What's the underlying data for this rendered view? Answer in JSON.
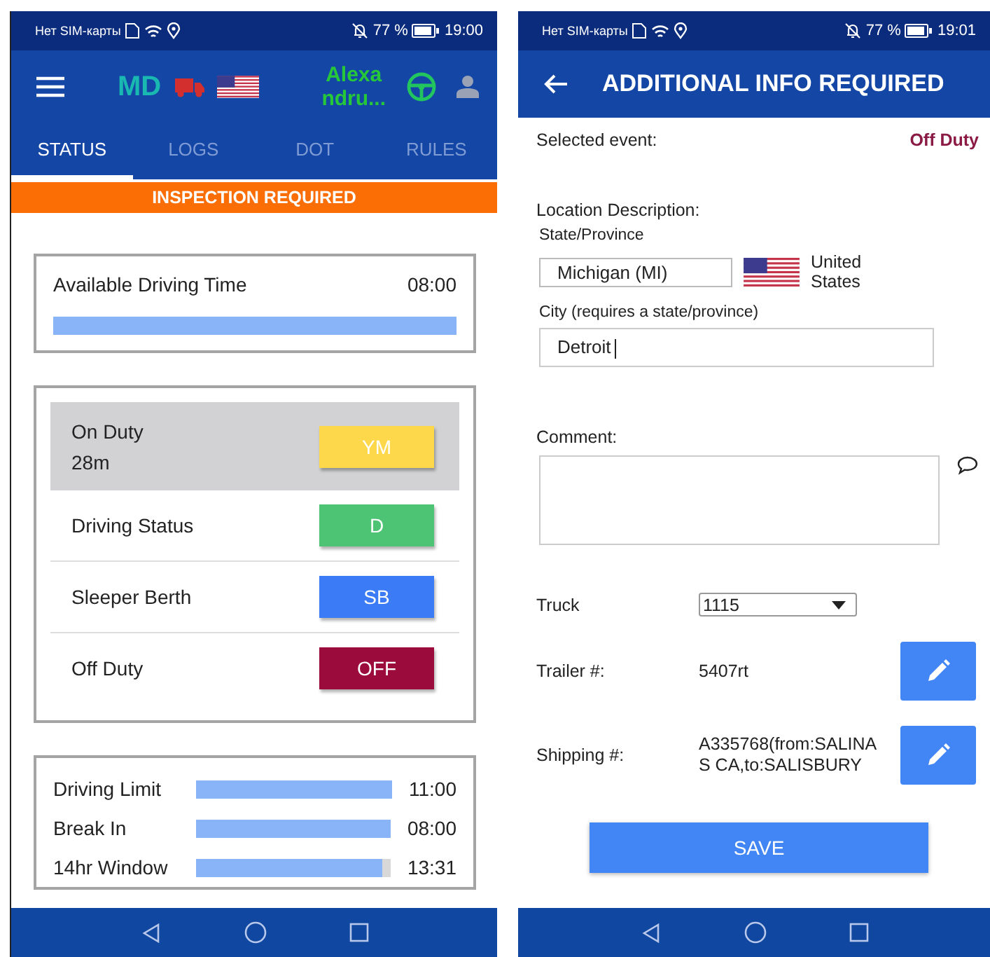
{
  "status_screen": {
    "status_bar": {
      "carrier": "Нет SIM-карты",
      "battery": "77 %",
      "time": "19:00"
    },
    "header": {
      "initials": "MD",
      "driver": "Alexandru..."
    },
    "tabs": [
      {
        "label": "STATUS",
        "selected": true
      },
      {
        "label": "LOGS",
        "selected": false
      },
      {
        "label": "DOT",
        "selected": false
      },
      {
        "label": "RULES",
        "selected": false
      }
    ],
    "banner": "INSPECTION REQUIRED",
    "available": {
      "label": "Available Driving Time",
      "value": "08:00",
      "level": 1
    },
    "statuses": [
      {
        "label": "On Duty",
        "sub": "28m",
        "code": "YM",
        "color": "#fdd84a",
        "selected": true
      },
      {
        "label": "Driving Status",
        "code": "D",
        "color": "#4cc474",
        "selected": false
      },
      {
        "label": "Sleeper Berth",
        "code": "SB",
        "color": "#3b7bf5",
        "selected": false
      },
      {
        "label": "Off Duty",
        "code": "OFF",
        "color": "#9b0c3c",
        "selected": false
      }
    ],
    "limits": [
      {
        "label": "Driving Limit",
        "value": "11:00",
        "level": 1
      },
      {
        "label": "Break In",
        "value": "08:00",
        "level": 1
      },
      {
        "label": "14hr Window",
        "value": "13:31",
        "level": 0.96
      }
    ]
  },
  "info_screen": {
    "status_bar": {
      "carrier": "Нет SIM-карты",
      "battery": "77 %",
      "time": "19:01"
    },
    "title": "ADDITIONAL INFO REQUIRED",
    "selected_event": {
      "label": "Selected event:",
      "value": "Off Duty"
    },
    "location_label": "Location Description:",
    "state": {
      "label": "State/Province",
      "value": "Michigan (MI)",
      "country": "United States"
    },
    "city": {
      "label": "City (requires a state/province)",
      "value": "Detroit"
    },
    "comment": {
      "label": "Comment:"
    },
    "truck": {
      "label": "Truck",
      "value": "1115"
    },
    "trailer": {
      "label": "Trailer #:",
      "value": "5407rt"
    },
    "shipping": {
      "label": "Shipping #:",
      "value": "A335768(from:SALINAS CA,to:SALISBURY"
    },
    "save": "SAVE"
  }
}
